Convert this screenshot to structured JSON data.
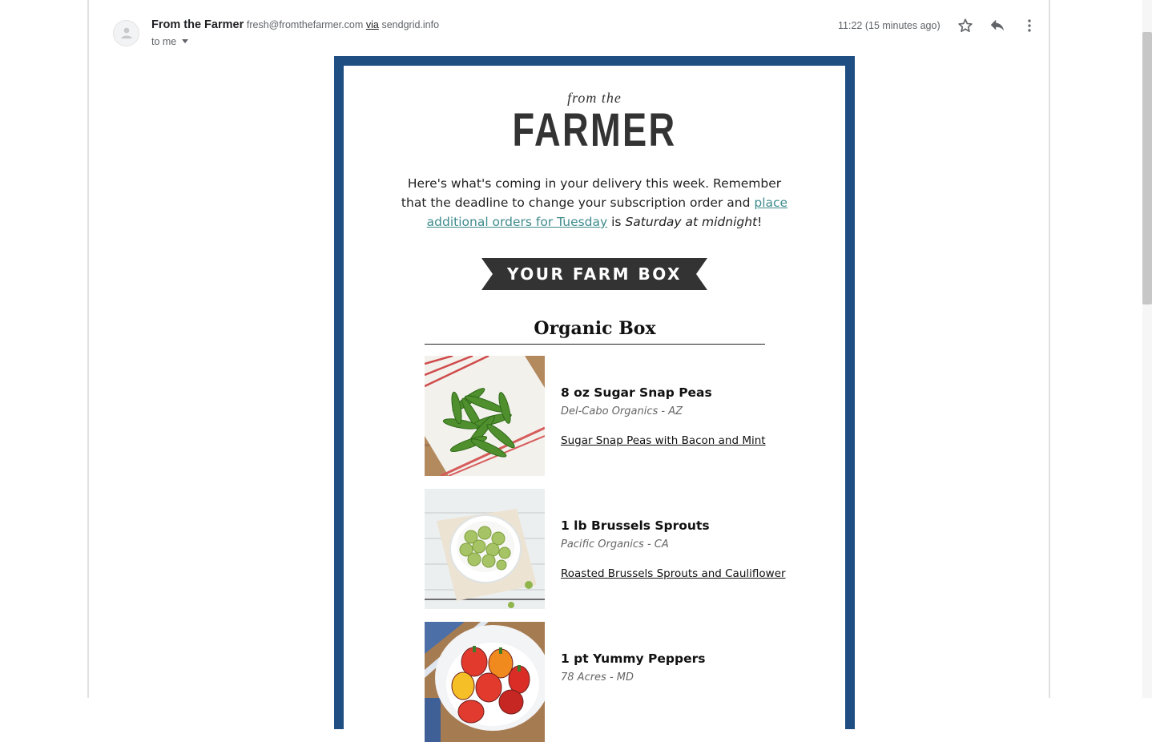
{
  "email_header": {
    "sender_name": "From the Farmer",
    "sender_email": "fresh@fromthefarmer.com",
    "via_label": "via",
    "via_domain": "sendgrid.info",
    "recipient_label": "to me",
    "timestamp": "11:22 (15 minutes ago)",
    "icons": [
      "avatar-placeholder-icon",
      "star-icon",
      "reply-icon",
      "more-options-icon",
      "chevron-down-icon"
    ]
  },
  "newsletter": {
    "brand_top": "from the",
    "brand_main": "FARMER",
    "intro": {
      "text_1": "Here's what's coming in your delivery this week. Remember that the deadline to change your subscription order and ",
      "link": "place additional orders for Tuesday",
      "text_2": " is ",
      "emphasis": "Saturday at midnight",
      "text_3": "!"
    },
    "banner": "YOUR FARM BOX",
    "section_title": "Organic Box",
    "products": [
      {
        "name": "8 oz Sugar Snap Peas",
        "farm": "Del-Cabo Organics - AZ",
        "recipe": "Sugar Snap Peas with Bacon and Mint"
      },
      {
        "name": "1 lb Brussels Sprouts",
        "farm": "Pacific Organics - CA",
        "recipe": "Roasted Brussels Sprouts and Cauliflower"
      },
      {
        "name": "1 pt Yummy Peppers",
        "farm": "78 Acres - MD"
      }
    ]
  },
  "colors": {
    "frame_blue": "#1f4e82",
    "link_teal": "#3f8b8d",
    "banner_dark": "#333333"
  }
}
